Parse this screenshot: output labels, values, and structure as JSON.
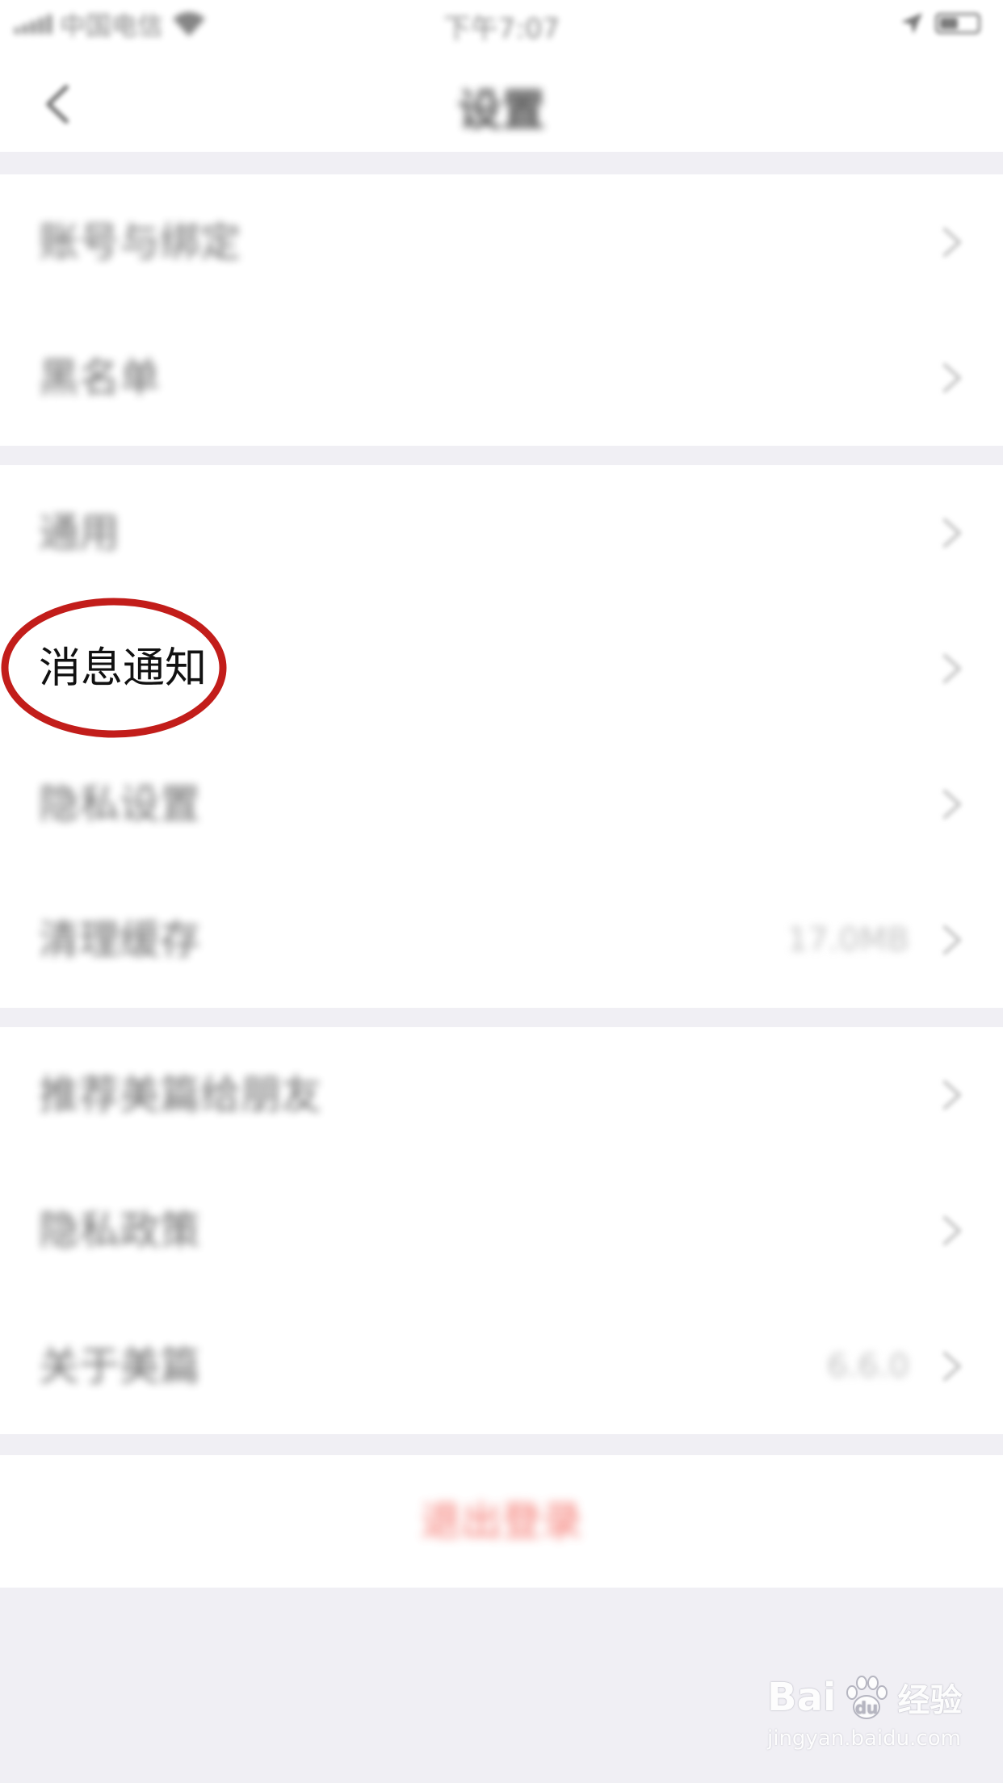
{
  "status_bar": {
    "carrier": "中国电信",
    "time": "下午7:07"
  },
  "nav": {
    "title": "设置",
    "back_icon": "chevron-left-icon"
  },
  "groups": [
    {
      "items": [
        {
          "label": "账号与绑定",
          "icon": "chevron-right-icon"
        },
        {
          "label": "黑名单",
          "icon": "chevron-right-icon"
        }
      ]
    },
    {
      "items": [
        {
          "label": "通用",
          "icon": "chevron-right-icon"
        },
        {
          "label": "消息通知",
          "icon": "chevron-right-icon",
          "highlighted": true
        },
        {
          "label": "隐私设置",
          "icon": "chevron-right-icon"
        },
        {
          "label": "清理缓存",
          "value": "17.0MB",
          "icon": "chevron-right-icon"
        }
      ]
    },
    {
      "items": [
        {
          "label": "推荐美篇给朋友",
          "icon": "chevron-right-icon"
        },
        {
          "label": "隐私政策",
          "icon": "chevron-right-icon"
        },
        {
          "label": "关于美篇",
          "value": "6.6.0",
          "icon": "chevron-right-icon"
        }
      ]
    }
  ],
  "logout": {
    "label": "退出登录"
  },
  "watermark": {
    "brand_left": "Bai",
    "brand_right": "经验",
    "url": "jingyan.baidu.com"
  },
  "colors": {
    "background": "#f0eff4",
    "logout_red": "#f2594f",
    "highlight_ring": "#c21d1a"
  }
}
